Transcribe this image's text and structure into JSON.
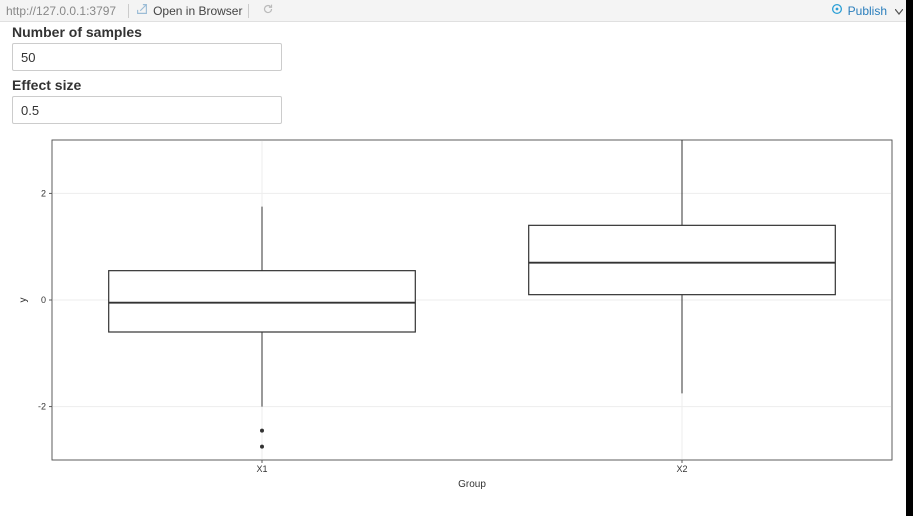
{
  "topbar": {
    "url": "http://127.0.0.1:3797",
    "open_label": "Open in Browser",
    "publish_label": "Publish"
  },
  "controls": {
    "samples_label": "Number of samples",
    "samples_value": "50",
    "effect_label": "Effect size",
    "effect_value": "0.5"
  },
  "chart_data": {
    "type": "boxplot",
    "xlabel": "Group",
    "ylabel": "y",
    "categories": [
      "X1",
      "X2"
    ],
    "ylim": [
      -3,
      3
    ],
    "yticks": [
      -2,
      0,
      2
    ],
    "series": [
      {
        "name": "X1",
        "q1": -0.6,
        "median": -0.05,
        "q3": 0.55,
        "lower_whisker": -2.0,
        "upper_whisker": 1.75,
        "outliers": [
          -2.45,
          -2.75
        ]
      },
      {
        "name": "X2",
        "q1": 0.1,
        "median": 0.7,
        "q3": 1.4,
        "lower_whisker": -1.75,
        "upper_whisker": 3.0,
        "outliers": []
      }
    ]
  }
}
